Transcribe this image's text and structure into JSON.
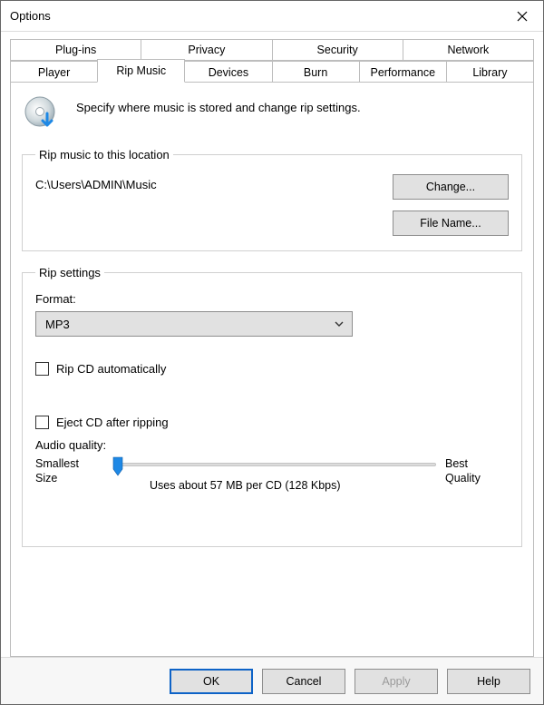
{
  "window": {
    "title": "Options"
  },
  "tabs": {
    "row1": [
      "Plug-ins",
      "Privacy",
      "Security",
      "Network"
    ],
    "row2": [
      "Player",
      "Rip Music",
      "Devices",
      "Burn",
      "Performance",
      "Library"
    ],
    "active": "Rip Music"
  },
  "intro": "Specify where music is stored and change rip settings.",
  "location": {
    "legend": "Rip music to this location",
    "path": "C:\\Users\\ADMIN\\Music",
    "change": "Change...",
    "filename": "File Name..."
  },
  "rip": {
    "legend": "Rip settings",
    "format_label": "Format:",
    "format_value": "MP3",
    "rip_auto": "Rip CD automatically",
    "eject_after": "Eject CD after ripping",
    "audio_quality_label": "Audio quality:",
    "smallest_l1": "Smallest",
    "smallest_l2": "Size",
    "best_l1": "Best",
    "best_l2": "Quality",
    "info": "Uses about 57 MB per CD (128 Kbps)"
  },
  "footer": {
    "ok": "OK",
    "cancel": "Cancel",
    "apply": "Apply",
    "help": "Help"
  }
}
